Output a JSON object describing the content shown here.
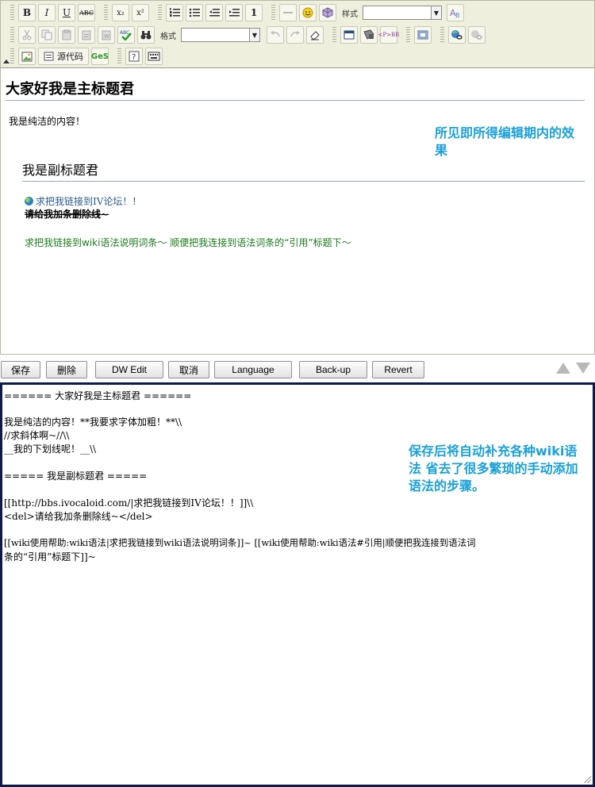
{
  "toolbar": {
    "bold_label": "B",
    "italic_label": "I",
    "underline_label": "U",
    "strike_label": "ABC",
    "subscript_label": "x₂",
    "superscript_label": "x²",
    "style_label": "样式",
    "format_label": "格式",
    "source_label": "源代码",
    "ges_label": "GeS",
    "para_label": "<P>BR"
  },
  "editor": {
    "heading1": "大家好我是主标题君",
    "paragraph1": "我是纯洁的内容！",
    "annotation": "所见即所得编辑期内的效果",
    "heading2": "我是副标题君",
    "link1": "求把我链接到IV论坛！！",
    "strikethrough": "请给我加条删除线~",
    "green_line": "求把我链接到wiki语法说明词条～ 顺便把我连接到语法词条的“引用”标题下～"
  },
  "buttons": {
    "save": "保存",
    "delete": "删除",
    "dw_edit": "DW Edit",
    "cancel": "取消",
    "language": "Language",
    "backup": "Back-up",
    "revert": "Revert"
  },
  "source": {
    "lines": [
      "====== 大家好我是主标题君 ======",
      "我是纯洁的内容！**我要求字体加粗！**\\\\",
      "//求斜体啊~//\\\\",
      "__我的下划线呢！__\\\\",
      "===== 我是副标题君 =====",
      "[[http://bbs.ivocaloid.com/|求把我链接到IV论坛！！]]\\\\",
      "<del>请给我加条删除线~</del>",
      "[[wiki使用帮助:wiki语法|求把我链接到wiki语法说明词条]]~ [[wiki使用帮助:wiki语法#引用|顺便把我连接到语法词",
      "条的“引用”标题下]]~"
    ],
    "annotation": "保存后将自动补充各种wiki语法 省去了很多繁琐的手动添加语法的步骤。"
  },
  "colors": {
    "annotation": "#1aa0d8",
    "green_text": "#1b7a1b",
    "link_text": "#2a5a8a",
    "toolbar_bg": "#efefde",
    "source_border": "#0a1a4a"
  }
}
